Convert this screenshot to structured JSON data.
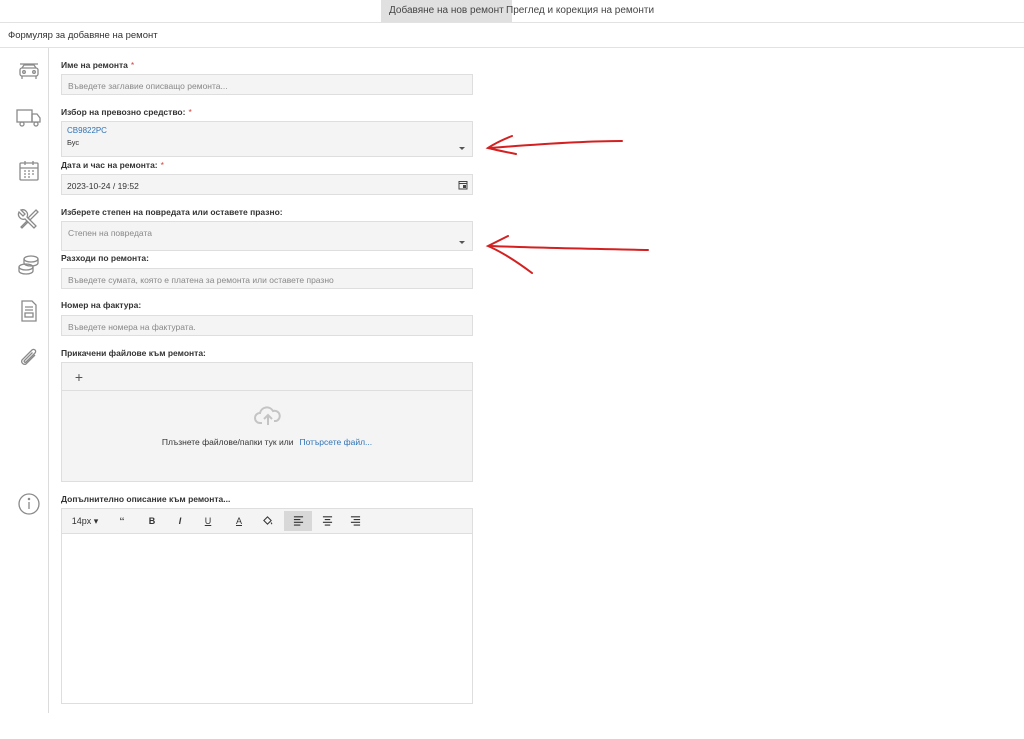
{
  "tabs": [
    {
      "label": "Добавяне на нов ремонт",
      "active": true
    },
    {
      "label": "Преглед и корекция на ремонти",
      "active": false
    }
  ],
  "form": {
    "title": "Формуляр за добавяне на ремонт",
    "repair_name": {
      "label": "Име на ремонта",
      "required": "*",
      "placeholder": "Въведете заглавие описващо ремонта..."
    },
    "vehicle": {
      "label": "Избор на превозно средство:",
      "required": "*",
      "plate": "СВ9822РС",
      "type": "Бус"
    },
    "datetime": {
      "label": "Дата и час на ремонта:",
      "required": "*",
      "value": "2023-10-24 / 19:52"
    },
    "damage": {
      "label": "Изберете степен на повредата или оставете празно:",
      "placeholder": "Степен на повредата"
    },
    "expenses": {
      "label": "Разходи по ремонта:",
      "placeholder": "Въведете сумата, която е платена за ремонта или оставете празно"
    },
    "invoice": {
      "label": "Номер на фактура:",
      "placeholder": "Въведете номера на фактурата."
    },
    "attachments": {
      "label": "Прикачени файлове към ремонта:",
      "add": "+",
      "drop_text": "Плъзнете файлове/папки тук или",
      "browse": "Потърсете файл..."
    },
    "description": {
      "label": "Допълнително описание към ремонта..."
    }
  },
  "editor_toolbar": {
    "font_size": "14px",
    "quote": "‘‘",
    "bold": "B",
    "italic": "I",
    "underline": "U",
    "text_color": "A",
    "active_alignment": "align-left"
  },
  "sidebar_icons": [
    "car-icon",
    "truck-icon",
    "calendar-icon",
    "tools-icon",
    "coins-icon",
    "invoice-icon",
    "paperclip-icon",
    "info-icon"
  ],
  "colors": {
    "link": "#2f73b6",
    "annotation": "#d42020",
    "required": "#d0433d"
  }
}
